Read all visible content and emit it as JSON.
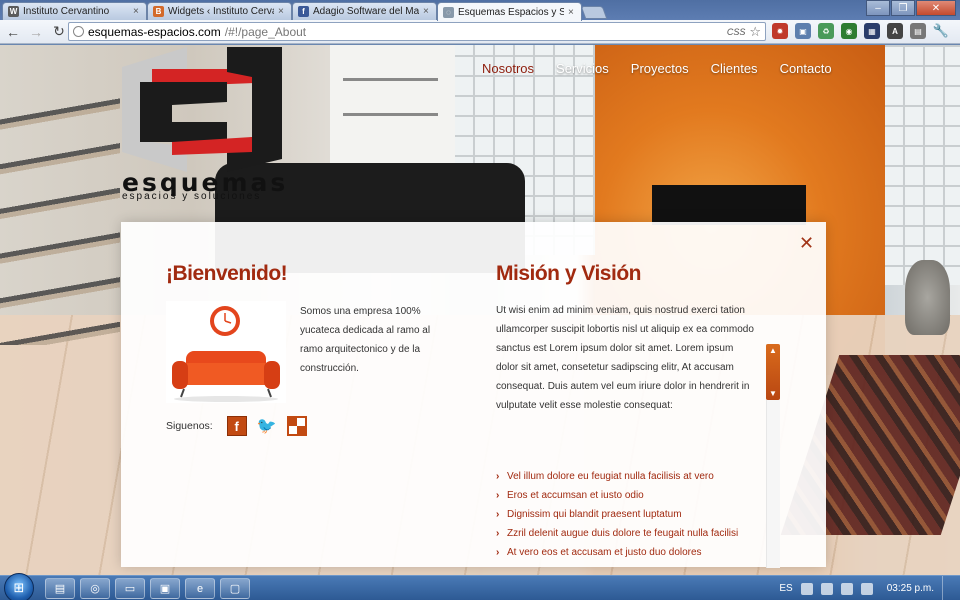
{
  "browser": {
    "tabs": [
      {
        "label": "Instituto Cervantino",
        "icon": "wordpress-icon",
        "color": "#5b5b5b"
      },
      {
        "label": "Widgets ‹ Instituto Cervanti",
        "icon": "blogger-icon",
        "color": "#d36a2b"
      },
      {
        "label": "Adagio Software del Mayal",
        "icon": "facebook-icon",
        "color": "#3b5998"
      },
      {
        "label": "Esquemas Espacios y Solu",
        "icon": "globe-icon",
        "color": "#8899aa",
        "active": true
      }
    ],
    "url_host": "esquemas-espacios.com",
    "url_path": "/#!/page_About",
    "css_tag": "CSS"
  },
  "site": {
    "logo_word": "esquemas",
    "logo_sub": "espacios y soluciones",
    "nav": [
      "Nosotros",
      "Servicios",
      "Proyectos",
      "Clientes",
      "Contacto"
    ],
    "active_nav": "Nosotros",
    "accent_color": "#a12a10"
  },
  "welcome": {
    "title": "¡Bienvenido!",
    "text": "Somos una empresa 100% yucateca dedicada al ramo al ramo arquitectonico y de la construcción.",
    "follow_label": "Siguenos:"
  },
  "mission": {
    "title": "Misión y Visión",
    "text": "Ut wisi enim ad minim veniam, quis nostrud exerci tation ullamcorper suscipit lobortis nisl ut aliquip ex ea commodo sanctus est Lorem ipsum dolor sit amet. Lorem ipsum dolor sit amet, consetetur sadipscing elitr, At accusam consequat. Duis autem vel eum iriure dolor in hendrerit in vulputate velit esse molestie consequat:",
    "items": [
      "Vel illum dolore eu feugiat nulla facilisis at vero",
      "Eros et accumsan et iusto odio",
      "Dignissim qui blandit praesent luptatum",
      "Zzril delenit augue duis dolore te feugait nulla facilisi",
      "At vero eos et accusam et justo duo dolores"
    ]
  },
  "taskbar": {
    "lang": "ES",
    "time": "03:25 p.m."
  }
}
